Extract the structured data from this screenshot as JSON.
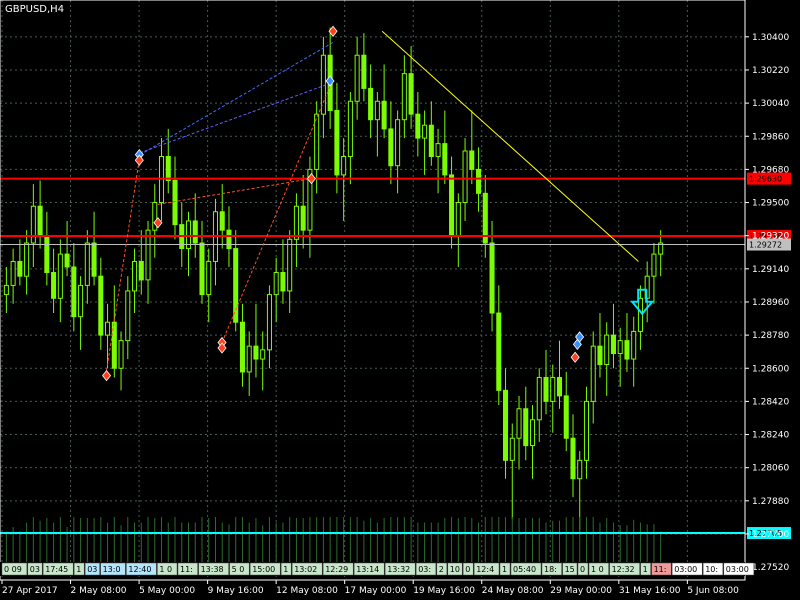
{
  "chart_data": {
    "type": "candlestick",
    "title": "GBPUSD,H4",
    "grid": true,
    "ylim": [
      1.2745,
      1.306
    ],
    "y_ticks": [
      1.304,
      1.3022,
      1.3004,
      1.2986,
      1.2968,
      1.295,
      1.2932,
      1.2914,
      1.2896,
      1.2878,
      1.286,
      1.2842,
      1.2824,
      1.2806,
      1.2788,
      1.277,
      1.2752
    ],
    "y_tick_labels": [
      "1.30400",
      "1.30220",
      "1.30040",
      "1.29860",
      "1.29680",
      "1.29500",
      "1.29320",
      "1.29140",
      "1.28960",
      "1.28780",
      "1.28600",
      "1.28420",
      "1.28240",
      "1.28060",
      "1.27880",
      "1.27700",
      "1.27520"
    ],
    "x_tick_labels": [
      "27 Apr 2017",
      "2 May 08:00",
      "5 May 00:00",
      "9 May 16:00",
      "12 May 08:00",
      "17 May 00:00",
      "19 May 16:00",
      "24 May 08:00",
      "29 May 00:00",
      "31 May 16:00",
      "5 Jun 08:00"
    ],
    "price_levels": [
      {
        "label": "1.29630",
        "value": 1.2963,
        "color": "#ff0000"
      },
      {
        "label": "1.29318",
        "value": 1.29318,
        "color": "#ff0000"
      },
      {
        "label": "1.29272",
        "value": 1.29272,
        "color": "#c0c0c0"
      },
      {
        "label": "1.27705",
        "value": 1.27705,
        "color": "#00ffff"
      }
    ],
    "trend_line": {
      "start": [
        0.513,
        1.3043
      ],
      "end": [
        0.857,
        1.2918
      ],
      "color": "#ffff00"
    },
    "dotted_lines": [
      {
        "start": [
          0.188,
          1.2976
        ],
        "end": [
          0.447,
          1.3037
        ],
        "color": "#3a6fff"
      },
      {
        "start": [
          0.188,
          1.2977
        ],
        "end": [
          0.445,
          1.3015
        ],
        "color": "#6060ff"
      },
      {
        "start": [
          0.142,
          1.2856
        ],
        "end": [
          0.188,
          1.2976
        ],
        "color": "#ff5020"
      },
      {
        "start": [
          0.298,
          1.2874
        ],
        "end": [
          0.445,
          1.3015
        ],
        "color": "#ff5020"
      },
      {
        "start": [
          0.212,
          1.2949
        ],
        "end": [
          0.418,
          1.2963
        ],
        "color": "#ff5020"
      }
    ],
    "markers": [
      {
        "x": 0.143,
        "y": 1.2856,
        "color": "#ff4020"
      },
      {
        "x": 0.187,
        "y": 1.2976,
        "color": "#3a8fff"
      },
      {
        "x": 0.187,
        "y": 1.2973,
        "color": "#ff4020"
      },
      {
        "x": 0.212,
        "y": 1.2939,
        "color": "#ff4020"
      },
      {
        "x": 0.298,
        "y": 1.2874,
        "color": "#ff4020"
      },
      {
        "x": 0.298,
        "y": 1.2871,
        "color": "#ff4020"
      },
      {
        "x": 0.418,
        "y": 1.2963,
        "color": "#ff4020"
      },
      {
        "x": 0.443,
        "y": 1.3016,
        "color": "#3a8fff"
      },
      {
        "x": 0.447,
        "y": 1.3043,
        "color": "#ff4020"
      },
      {
        "x": 0.772,
        "y": 1.2866,
        "color": "#ff4020"
      },
      {
        "x": 0.775,
        "y": 1.2873,
        "color": "#3a8fff"
      },
      {
        "x": 0.778,
        "y": 1.2877,
        "color": "#3a8fff"
      }
    ],
    "signal_arrow": {
      "x": 0.862,
      "y": 1.2895,
      "direction": "down",
      "color": "#00e5ff"
    },
    "separator_labels": [
      "0 09",
      "03",
      "17:45",
      "1",
      "03",
      "13:0",
      "12:40",
      "1 0",
      "11:",
      "13:38",
      "5 0",
      "15:00",
      "1",
      "13:02",
      "12:29",
      "13:14",
      "13:32",
      "03:",
      "2",
      "10",
      "0",
      "12:4",
      "1",
      "05:40",
      "18:",
      "15",
      "0",
      "1 0",
      "12:32",
      "1",
      "11:",
      "03:00",
      "10:",
      "03:00"
    ],
    "series": [
      {
        "name": "GBPUSD,H4",
        "ohlc": [
          [
            1.29,
            1.2915,
            1.289,
            1.2905
          ],
          [
            1.2905,
            1.2925,
            1.2895,
            1.2918
          ],
          [
            1.2918,
            1.293,
            1.2905,
            1.291
          ],
          [
            1.291,
            1.2935,
            1.29,
            1.2928
          ],
          [
            1.2928,
            1.296,
            1.2915,
            1.2948
          ],
          [
            1.2948,
            1.2962,
            1.2925,
            1.2932
          ],
          [
            1.2932,
            1.2945,
            1.2905,
            1.2912
          ],
          [
            1.2912,
            1.2925,
            1.289,
            1.2898
          ],
          [
            1.2898,
            1.293,
            1.2885,
            1.2922
          ],
          [
            1.2922,
            1.294,
            1.291,
            1.2915
          ],
          [
            1.2915,
            1.2928,
            1.288,
            1.2888
          ],
          [
            1.2888,
            1.291,
            1.287,
            1.2905
          ],
          [
            1.2905,
            1.2935,
            1.2895,
            1.2928
          ],
          [
            1.2928,
            1.2945,
            1.2905,
            1.291
          ],
          [
            1.291,
            1.292,
            1.287,
            1.2878
          ],
          [
            1.2878,
            1.2895,
            1.286,
            1.2885
          ],
          [
            1.2885,
            1.2905,
            1.2855,
            1.286
          ],
          [
            1.286,
            1.288,
            1.2848,
            1.2875
          ],
          [
            1.2875,
            1.291,
            1.2865,
            1.2902
          ],
          [
            1.2902,
            1.2925,
            1.289,
            1.2918
          ],
          [
            1.2918,
            1.2935,
            1.29,
            1.2908
          ],
          [
            1.2908,
            1.294,
            1.2895,
            1.2935
          ],
          [
            1.2935,
            1.296,
            1.292,
            1.295
          ],
          [
            1.295,
            1.2985,
            1.294,
            1.2975
          ],
          [
            1.2975,
            1.299,
            1.2955,
            1.2962
          ],
          [
            1.2962,
            1.2975,
            1.293,
            1.2938
          ],
          [
            1.2938,
            1.295,
            1.2915,
            1.2925
          ],
          [
            1.2925,
            1.2945,
            1.291,
            1.294
          ],
          [
            1.294,
            1.2955,
            1.292,
            1.2928
          ],
          [
            1.2928,
            1.294,
            1.2895,
            1.29
          ],
          [
            1.29,
            1.2925,
            1.2885,
            1.2918
          ],
          [
            1.2918,
            1.2952,
            1.2905,
            1.2945
          ],
          [
            1.2945,
            1.296,
            1.2925,
            1.2935
          ],
          [
            1.2935,
            1.2948,
            1.2915,
            1.2925
          ],
          [
            1.2925,
            1.2935,
            1.288,
            1.2885
          ],
          [
            1.2885,
            1.2895,
            1.285,
            1.2858
          ],
          [
            1.2858,
            1.288,
            1.2845,
            1.2872
          ],
          [
            1.2872,
            1.2895,
            1.2855,
            1.2865
          ],
          [
            1.2865,
            1.288,
            1.2848,
            1.287
          ],
          [
            1.287,
            1.2905,
            1.286,
            1.29
          ],
          [
            1.29,
            1.292,
            1.2885,
            1.2912
          ],
          [
            1.2912,
            1.293,
            1.2895,
            1.2902
          ],
          [
            1.2902,
            1.2935,
            1.289,
            1.293
          ],
          [
            1.293,
            1.2955,
            1.2915,
            1.2948
          ],
          [
            1.2948,
            1.2965,
            1.2925,
            1.2935
          ],
          [
            1.2935,
            1.2975,
            1.292,
            1.2968
          ],
          [
            1.2968,
            1.3005,
            1.2955,
            1.2998
          ],
          [
            1.2998,
            1.304,
            1.2985,
            1.303
          ],
          [
            1.303,
            1.3045,
            1.299,
            1.3
          ],
          [
            1.3,
            1.3015,
            1.2955,
            1.2965
          ],
          [
            1.2965,
            1.2985,
            1.294,
            1.2975
          ],
          [
            1.2975,
            1.301,
            1.296,
            1.3005
          ],
          [
            1.3005,
            1.304,
            1.2995,
            1.303
          ],
          [
            1.303,
            1.3042,
            1.3005,
            1.3012
          ],
          [
            1.3012,
            1.3025,
            1.2985,
            1.2995
          ],
          [
            1.2995,
            1.301,
            1.2975,
            1.3005
          ],
          [
            1.3005,
            1.3025,
            1.2985,
            1.299
          ],
          [
            1.299,
            1.3005,
            1.296,
            1.297
          ],
          [
            1.297,
            1.3,
            1.2955,
            1.2995
          ],
          [
            1.2995,
            1.303,
            1.2985,
            1.302
          ],
          [
            1.302,
            1.3035,
            1.299,
            1.2998
          ],
          [
            1.2998,
            1.301,
            1.2975,
            1.2985
          ],
          [
            1.2985,
            1.3,
            1.2965,
            1.2992
          ],
          [
            1.2992,
            1.3005,
            1.297,
            1.2975
          ],
          [
            1.2975,
            1.299,
            1.2955,
            1.2982
          ],
          [
            1.2982,
            1.3,
            1.296,
            1.2965
          ],
          [
            1.2965,
            1.2975,
            1.2925,
            1.2932
          ],
          [
            1.2932,
            1.2955,
            1.2915,
            1.295
          ],
          [
            1.295,
            1.2985,
            1.294,
            1.2978
          ],
          [
            1.2978,
            1.3,
            1.296,
            1.2968
          ],
          [
            1.2968,
            1.298,
            1.2945,
            1.2955
          ],
          [
            1.2955,
            1.2965,
            1.292,
            1.2928
          ],
          [
            1.2928,
            1.294,
            1.288,
            1.289
          ],
          [
            1.289,
            1.2905,
            1.284,
            1.2848
          ],
          [
            1.2848,
            1.286,
            1.28,
            1.281
          ],
          [
            1.281,
            1.283,
            1.2778,
            1.2822
          ],
          [
            1.2822,
            1.2845,
            1.2805,
            1.2838
          ],
          [
            1.2838,
            1.285,
            1.281,
            1.2818
          ],
          [
            1.2818,
            1.284,
            1.28,
            1.2832
          ],
          [
            1.2832,
            1.286,
            1.282,
            1.2855
          ],
          [
            1.2855,
            1.287,
            1.2835,
            1.2842
          ],
          [
            1.2842,
            1.2862,
            1.2825,
            1.2855
          ],
          [
            1.2855,
            1.2875,
            1.2838,
            1.2845
          ],
          [
            1.2845,
            1.2858,
            1.2815,
            1.2822
          ],
          [
            1.2822,
            1.2835,
            1.279,
            1.28
          ],
          [
            1.28,
            1.2815,
            1.2772,
            1.281
          ],
          [
            1.281,
            1.285,
            1.28,
            1.2842
          ],
          [
            1.2842,
            1.288,
            1.283,
            1.2872
          ],
          [
            1.2872,
            1.289,
            1.2855,
            1.2862
          ],
          [
            1.2862,
            1.2885,
            1.2845,
            1.2878
          ],
          [
            1.2878,
            1.2895,
            1.286,
            1.2868
          ],
          [
            1.2868,
            1.2882,
            1.285,
            1.2875
          ],
          [
            1.2875,
            1.289,
            1.2858,
            1.2865
          ],
          [
            1.2865,
            1.2888,
            1.285,
            1.288
          ],
          [
            1.288,
            1.2905,
            1.287,
            1.2898
          ],
          [
            1.2898,
            1.2918,
            1.2885,
            1.291
          ],
          [
            1.291,
            1.2928,
            1.2895,
            1.2922
          ],
          [
            1.2922,
            1.2935,
            1.291,
            1.2928
          ]
        ]
      }
    ]
  }
}
